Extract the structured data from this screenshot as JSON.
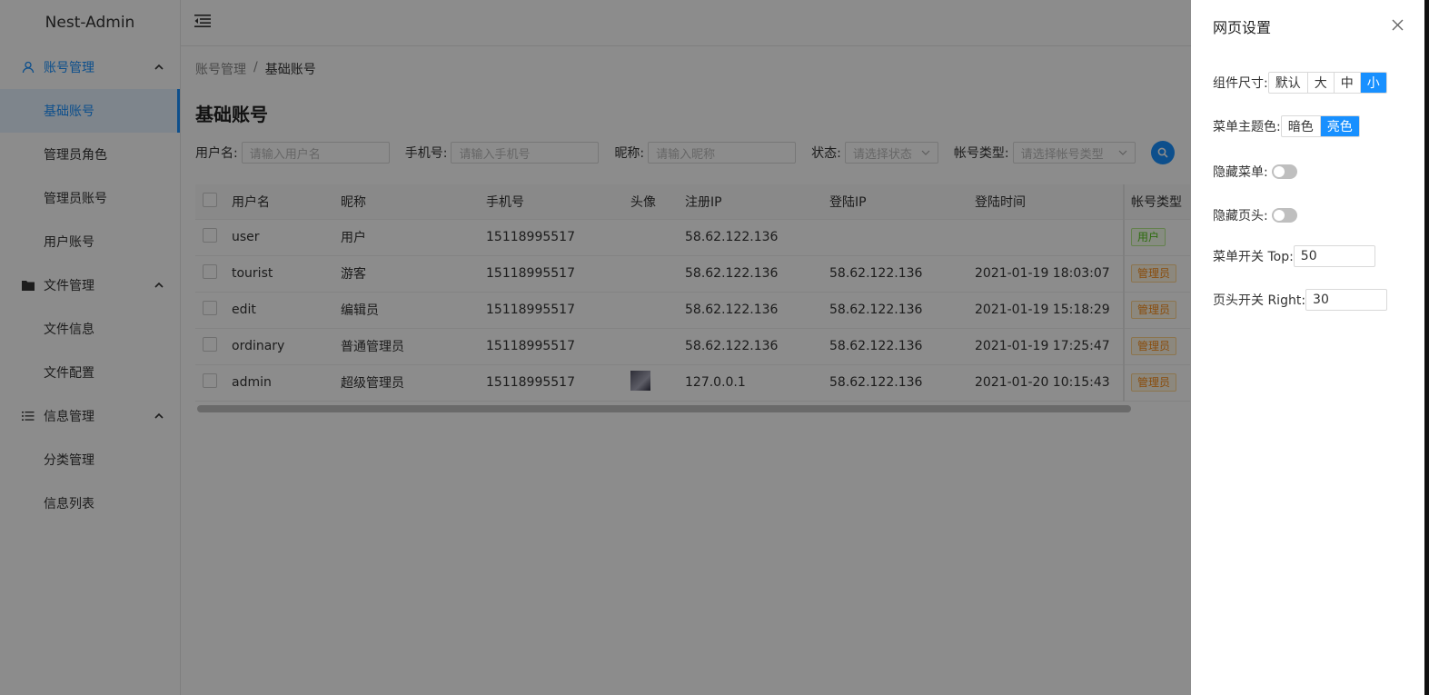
{
  "app": {
    "title": "Nest-Admin"
  },
  "sidebar": {
    "groups": [
      {
        "label": "账号管理",
        "icon": "user-icon",
        "items": [
          "基础账号",
          "管理员角色",
          "管理员账号",
          "用户账号"
        ]
      },
      {
        "label": "文件管理",
        "icon": "folder-icon",
        "items": [
          "文件信息",
          "文件配置"
        ]
      },
      {
        "label": "信息管理",
        "icon": "list-icon",
        "items": [
          "分类管理",
          "信息列表"
        ]
      }
    ],
    "selected": "基础账号"
  },
  "breadcrumb": {
    "parent": "账号管理",
    "separator": "/",
    "current": "基础账号"
  },
  "page": {
    "title": "基础账号"
  },
  "filters": {
    "username": {
      "label": "用户名:",
      "placeholder": "请输入用户名"
    },
    "phone": {
      "label": "手机号:",
      "placeholder": "请输入手机号"
    },
    "nickname": {
      "label": "昵称:",
      "placeholder": "请输入昵称"
    },
    "status": {
      "label": "状态:",
      "placeholder": "请选择状态"
    },
    "account_type": {
      "label": "帐号类型:",
      "placeholder": "请选择帐号类型"
    }
  },
  "table": {
    "headers": {
      "username": "用户名",
      "nickname": "昵称",
      "phone": "手机号",
      "avatar": "头像",
      "reg_ip": "注册IP",
      "login_ip": "登陆IP",
      "login_time": "登陆时间",
      "type": "帐号类型"
    },
    "rows": [
      {
        "username": "user",
        "nickname": "用户",
        "phone": "15118995517",
        "has_avatar": false,
        "reg_ip": "58.62.122.136",
        "login_ip": "",
        "login_time": "",
        "type": "用户",
        "type_color": "green"
      },
      {
        "username": "tourist",
        "nickname": "游客",
        "phone": "15118995517",
        "has_avatar": false,
        "reg_ip": "58.62.122.136",
        "login_ip": "58.62.122.136",
        "login_time": "2021-01-19 18:03:07",
        "type": "管理员",
        "type_color": "orange"
      },
      {
        "username": "edit",
        "nickname": "编辑员",
        "phone": "15118995517",
        "has_avatar": false,
        "reg_ip": "58.62.122.136",
        "login_ip": "58.62.122.136",
        "login_time": "2021-01-19 15:18:29",
        "type": "管理员",
        "type_color": "orange"
      },
      {
        "username": "ordinary",
        "nickname": "普通管理员",
        "phone": "15118995517",
        "has_avatar": false,
        "reg_ip": "58.62.122.136",
        "login_ip": "58.62.122.136",
        "login_time": "2021-01-19 17:25:47",
        "type": "管理员",
        "type_color": "orange"
      },
      {
        "username": "admin",
        "nickname": "超级管理员",
        "phone": "15118995517",
        "has_avatar": true,
        "reg_ip": "127.0.0.1",
        "login_ip": "58.62.122.136",
        "login_time": "2021-01-20 10:15:43",
        "type": "管理员",
        "type_color": "orange"
      }
    ]
  },
  "drawer": {
    "title": "网页设置",
    "component_size": {
      "label": "组件尺寸:",
      "options": [
        "默认",
        "大",
        "中",
        "小"
      ],
      "selected": "小"
    },
    "menu_theme": {
      "label": "菜单主题色:",
      "options": [
        "暗色",
        "亮色"
      ],
      "selected": "亮色"
    },
    "hide_menu": {
      "label": "隐藏菜单:",
      "on": false
    },
    "hide_header": {
      "label": "隐藏页头:",
      "on": false
    },
    "menu_toggle_top": {
      "label": "菜单开关 Top:",
      "value": "50"
    },
    "header_toggle_right": {
      "label": "页头开关 Right:",
      "value": "30"
    }
  },
  "colors": {
    "primary": "#1890ff",
    "overlay": "rgba(0,0,0,0.45)",
    "tag_user": "#52c41a",
    "tag_admin": "#fa8c16"
  }
}
